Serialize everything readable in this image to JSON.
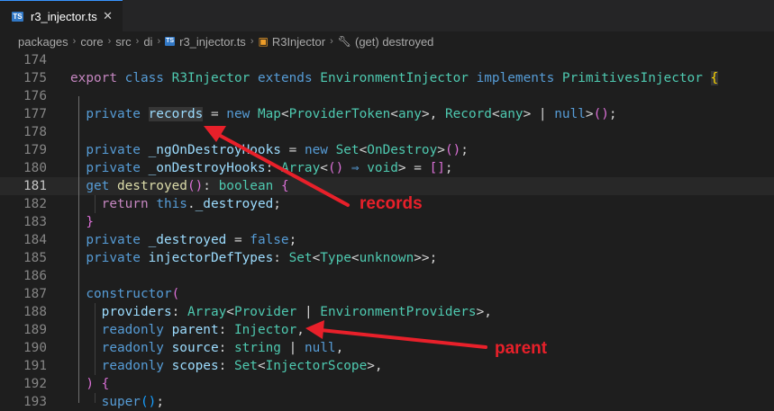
{
  "tab": {
    "icon": "ts-file-icon",
    "icon_text": "TS",
    "label": "r3_injector.ts",
    "close": "✕"
  },
  "breadcrumb": {
    "parts": [
      "packages",
      "core",
      "src",
      "di"
    ],
    "file": "r3_injector.ts",
    "class_name": "R3Injector",
    "member": "(get) destroyed",
    "separator": "›"
  },
  "editor": {
    "active_line": "181",
    "line_numbers": [
      "174",
      "175",
      "176",
      "177",
      "178",
      "179",
      "180",
      "181",
      "182",
      "183",
      "184",
      "185",
      "186",
      "187",
      "188",
      "189",
      "190",
      "191",
      "192",
      "193"
    ],
    "lines": [
      [],
      [
        [
          "export",
          "ctl"
        ],
        [
          " ",
          ""
        ],
        [
          "class",
          "kw"
        ],
        [
          " ",
          ""
        ],
        [
          "R3Injector",
          "ty"
        ],
        [
          " ",
          ""
        ],
        [
          "extends",
          "kw"
        ],
        [
          " ",
          ""
        ],
        [
          "EnvironmentInjector",
          "ty"
        ],
        [
          " ",
          ""
        ],
        [
          "implements",
          "kw"
        ],
        [
          " ",
          ""
        ],
        [
          "PrimitivesInjector",
          "ty"
        ],
        [
          " ",
          ""
        ],
        [
          "{",
          "b1 hl"
        ]
      ],
      [],
      [
        [
          "  private ",
          "kw"
        ],
        [
          "records",
          "id hl"
        ],
        [
          " = ",
          "op"
        ],
        [
          "new",
          "kw"
        ],
        [
          " ",
          ""
        ],
        [
          "Map",
          "ty"
        ],
        [
          "<",
          "op"
        ],
        [
          "ProviderToken",
          "ty"
        ],
        [
          "<",
          "op"
        ],
        [
          "any",
          "ty"
        ],
        [
          ">, ",
          "op"
        ],
        [
          "Record",
          "ty"
        ],
        [
          "<",
          "op"
        ],
        [
          "any",
          "ty"
        ],
        [
          "> | ",
          "op"
        ],
        [
          "null",
          "kw"
        ],
        [
          ">",
          "op"
        ],
        [
          "()",
          "b2"
        ],
        [
          ";",
          "op"
        ]
      ],
      [],
      [
        [
          "  private ",
          "kw"
        ],
        [
          "_ngOnDestroyHooks",
          "id"
        ],
        [
          " = ",
          "op"
        ],
        [
          "new",
          "kw"
        ],
        [
          " ",
          ""
        ],
        [
          "Set",
          "ty"
        ],
        [
          "<",
          "op"
        ],
        [
          "OnDestroy",
          "ty"
        ],
        [
          ">",
          "op"
        ],
        [
          "()",
          "b2"
        ],
        [
          ";",
          "op"
        ]
      ],
      [
        [
          "  private ",
          "kw"
        ],
        [
          "_onDestroyHooks",
          "id"
        ],
        [
          ": ",
          "op"
        ],
        [
          "Array",
          "ty"
        ],
        [
          "<",
          "op"
        ],
        [
          "()",
          "b2"
        ],
        [
          " ⇒ ",
          "kw"
        ],
        [
          "void",
          "ty"
        ],
        [
          "> = ",
          "op"
        ],
        [
          "[]",
          "b2"
        ],
        [
          ";",
          "op"
        ]
      ],
      [
        [
          "  get ",
          "kw"
        ],
        [
          "destroyed",
          "fn"
        ],
        [
          "()",
          "b2"
        ],
        [
          ": ",
          "op"
        ],
        [
          "boolean",
          "ty"
        ],
        [
          " ",
          ""
        ],
        [
          "{",
          "b2"
        ]
      ],
      [
        [
          "    return ",
          "ctl"
        ],
        [
          "this",
          "kw"
        ],
        [
          ".",
          "op"
        ],
        [
          "_destroyed",
          "id"
        ],
        [
          ";",
          "op"
        ]
      ],
      [
        [
          "  ",
          ""
        ],
        [
          "}",
          "b2"
        ]
      ],
      [
        [
          "  private ",
          "kw"
        ],
        [
          "_destroyed",
          "id"
        ],
        [
          " = ",
          "op"
        ],
        [
          "false",
          "kw"
        ],
        [
          ";",
          "op"
        ]
      ],
      [
        [
          "  private ",
          "kw"
        ],
        [
          "injectorDefTypes",
          "id"
        ],
        [
          ": ",
          "op"
        ],
        [
          "Set",
          "ty"
        ],
        [
          "<",
          "op"
        ],
        [
          "Type",
          "ty"
        ],
        [
          "<",
          "op"
        ],
        [
          "unknown",
          "ty"
        ],
        [
          ">>",
          "op"
        ],
        [
          ";",
          "op"
        ]
      ],
      [],
      [
        [
          "  ",
          ""
        ],
        [
          "constructor",
          "kw"
        ],
        [
          "(",
          "b2"
        ]
      ],
      [
        [
          "    providers",
          "id"
        ],
        [
          ": ",
          "op"
        ],
        [
          "Array",
          "ty"
        ],
        [
          "<",
          "op"
        ],
        [
          "Provider",
          "ty"
        ],
        [
          " | ",
          "op"
        ],
        [
          "EnvironmentProviders",
          "ty"
        ],
        [
          ">,",
          "op"
        ]
      ],
      [
        [
          "    readonly ",
          "kw"
        ],
        [
          "parent",
          "id"
        ],
        [
          ": ",
          "op"
        ],
        [
          "Injector",
          "ty"
        ],
        [
          ",",
          "op"
        ]
      ],
      [
        [
          "    readonly ",
          "kw"
        ],
        [
          "source",
          "id"
        ],
        [
          ": ",
          "op"
        ],
        [
          "string",
          "ty"
        ],
        [
          " | ",
          "op"
        ],
        [
          "null",
          "kw"
        ],
        [
          ",",
          "op"
        ]
      ],
      [
        [
          "    readonly ",
          "kw"
        ],
        [
          "scopes",
          "id"
        ],
        [
          ": ",
          "op"
        ],
        [
          "Set",
          "ty"
        ],
        [
          "<",
          "op"
        ],
        [
          "InjectorScope",
          "ty"
        ],
        [
          ">,",
          "op"
        ]
      ],
      [
        [
          "  ",
          ""
        ],
        [
          ")",
          "b2"
        ],
        [
          " ",
          ""
        ],
        [
          "{",
          "b2"
        ]
      ],
      [
        [
          "    ",
          ""
        ],
        [
          "super",
          "kw"
        ],
        [
          "()",
          "b3"
        ],
        [
          ";",
          "op"
        ]
      ]
    ]
  },
  "annotations": {
    "records": "records",
    "parent": "parent",
    "color": "#e8202a"
  }
}
